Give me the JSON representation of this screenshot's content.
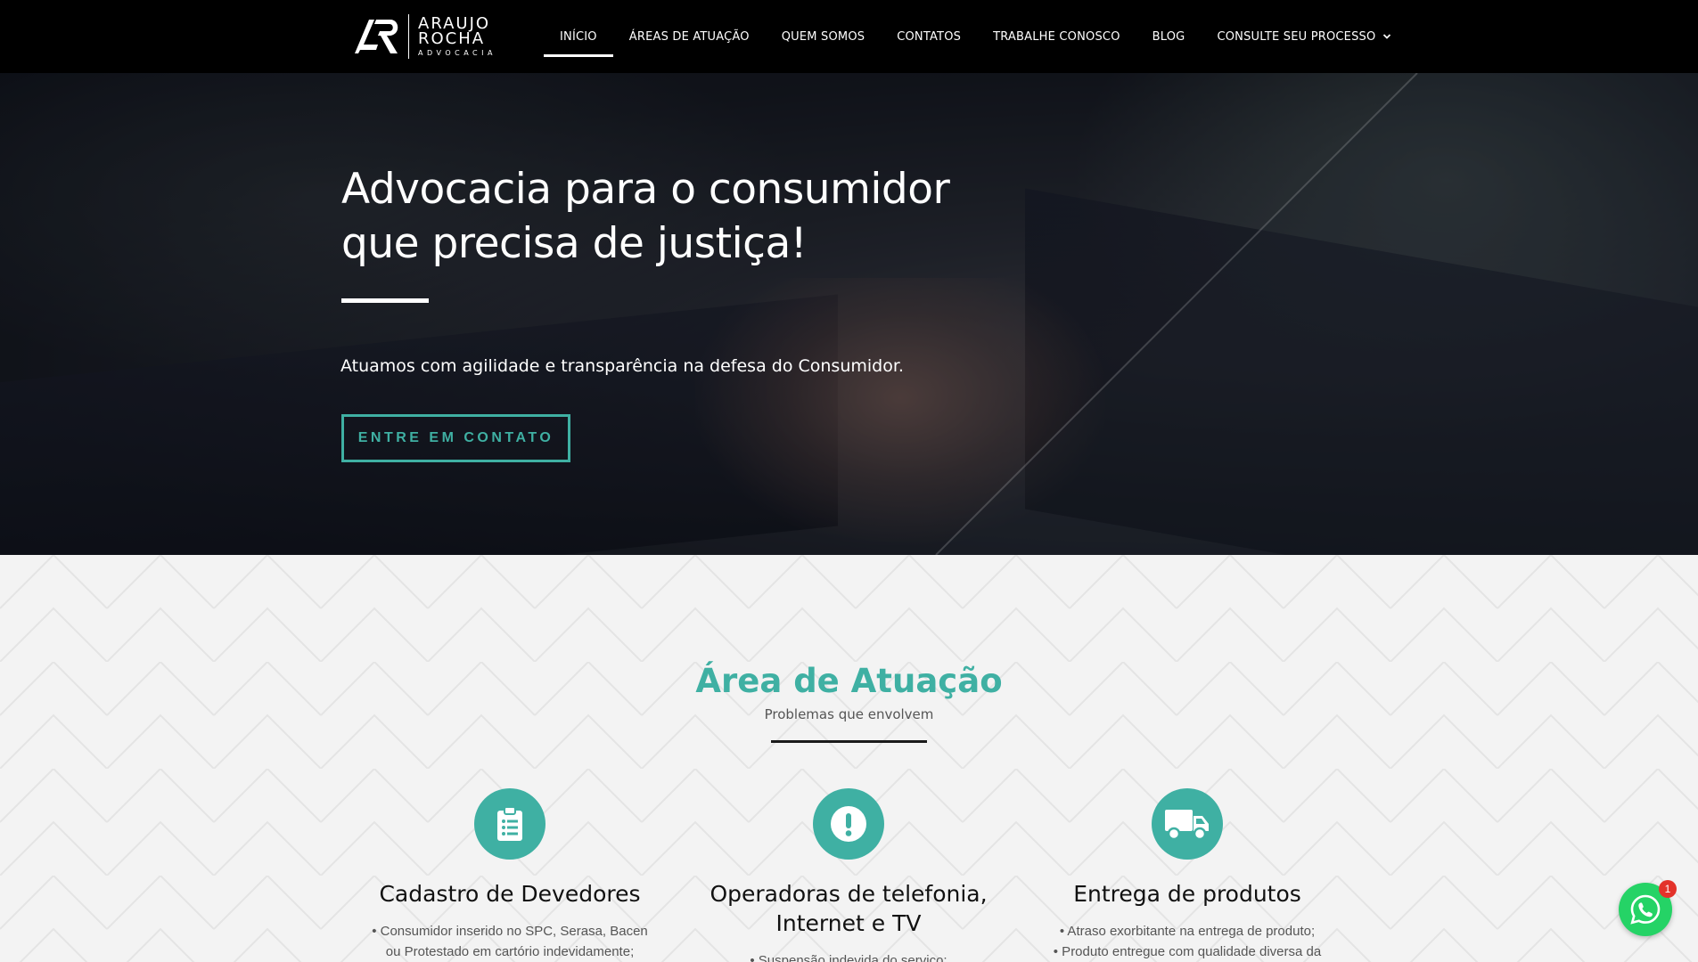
{
  "brand": {
    "logo_line1": "ARAUJO",
    "logo_line2": "ROCHA",
    "logo_line3": "ADVOCACIA"
  },
  "nav": {
    "items": [
      {
        "label": "INÍCIO",
        "active": true
      },
      {
        "label": "ÁREAS DE ATUAÇÃO"
      },
      {
        "label": "QUEM SOMOS"
      },
      {
        "label": "CONTATOS"
      },
      {
        "label": "TRABALHE CONOSCO"
      },
      {
        "label": "BLOG"
      },
      {
        "label": "CONSULTE SEU PROCESSO",
        "dropdown": true,
        "icon": "chevron-down-icon"
      }
    ]
  },
  "hero": {
    "title_line1": "Advocacia para o consumidor",
    "title_line2": "que precisa de justiça!",
    "subtitle": "Atuamos com agilidade e transparência na defesa do Consumidor.",
    "cta_label": "ENTRE EM CONTATO"
  },
  "area": {
    "title": "Área de Atuação",
    "subtitle": "Problemas que envolvem",
    "cards": [
      {
        "icon": "clipboard-list-icon",
        "title_line1": "Cadastro de Devedores",
        "title_line2": "",
        "lines": [
          "• Consumidor inserido no SPC, Serasa, Bacen",
          "ou Protestado em cartório indevidamente;"
        ]
      },
      {
        "icon": "exclamation-circle-icon",
        "title_line1": "Operadoras de telefonia,",
        "title_line2": "Internet e TV",
        "lines": [
          "• Suspensão indevida do serviço;"
        ]
      },
      {
        "icon": "truck-icon",
        "title_line1": "Entrega de produtos",
        "title_line2": "",
        "lines": [
          "• Atraso exorbitante na entrega de produto;",
          "• Produto entregue com qualidade diversa da"
        ]
      }
    ]
  },
  "whatsapp": {
    "icon": "whatsapp-icon",
    "badge": "1"
  },
  "colors": {
    "accent": "#3fb0a3",
    "header_bg": "#000000",
    "whatsapp": "#25d366",
    "badge": "#e3322a"
  }
}
